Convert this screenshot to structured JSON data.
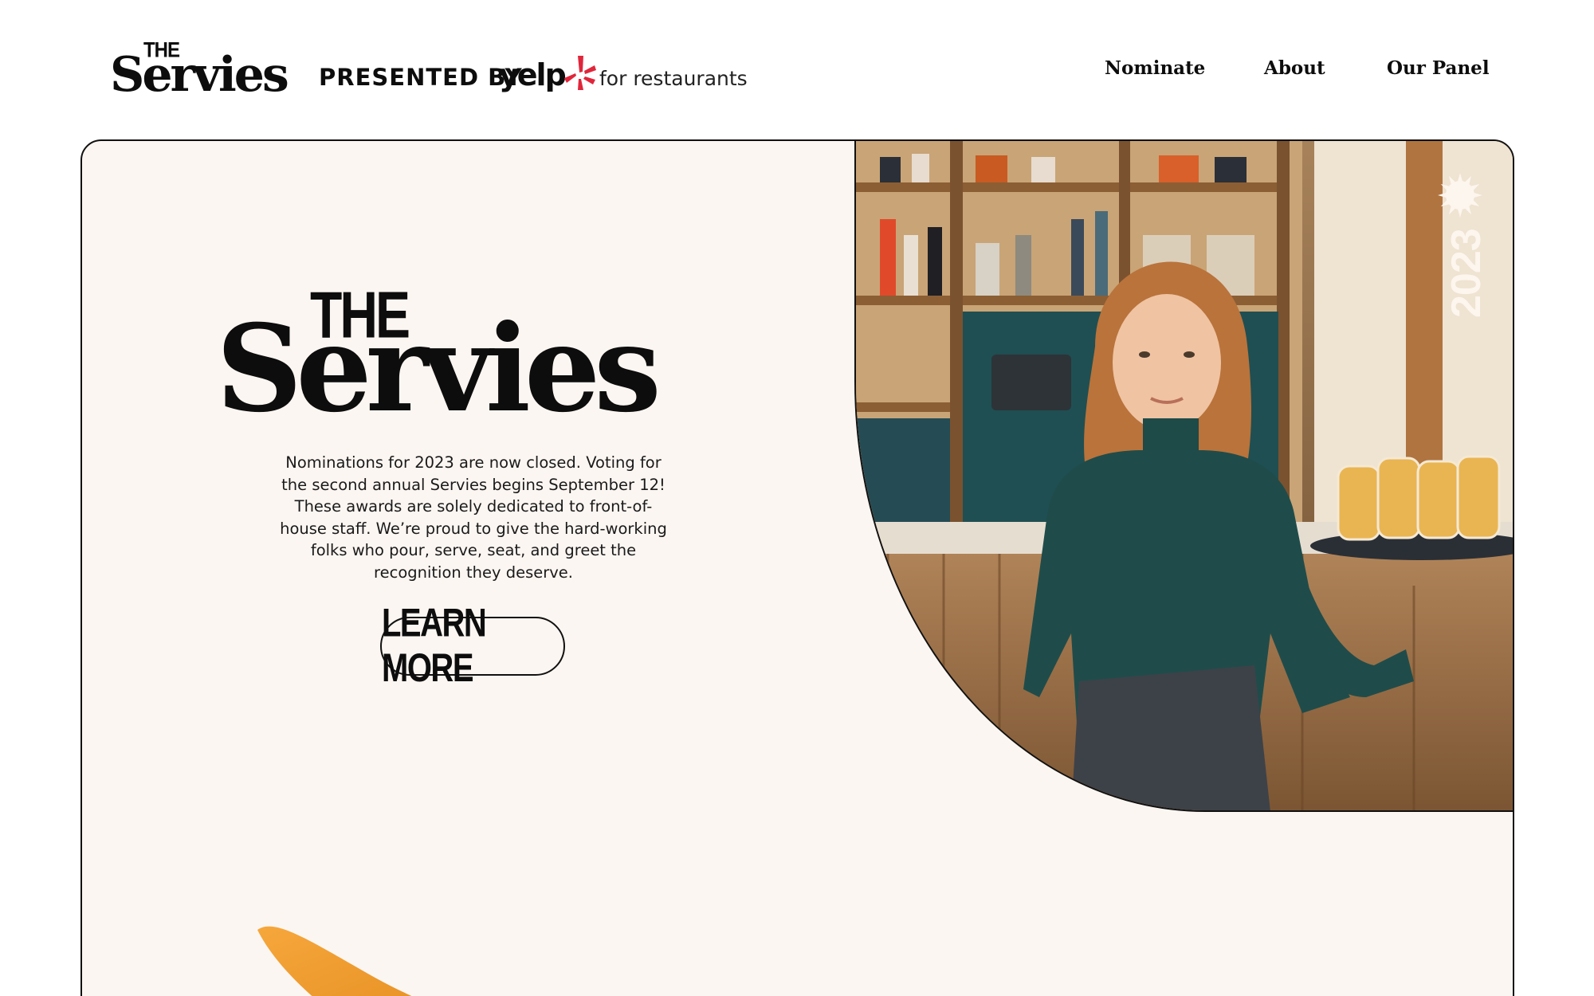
{
  "header": {
    "logo_the": "THE",
    "logo_servies": "Servies",
    "presented_by": "PRESENTED BY",
    "yelp": "yelp",
    "for_restaurants": "for restaurants",
    "nav": [
      {
        "label": "Nominate"
      },
      {
        "label": "About"
      },
      {
        "label": "Our Panel"
      }
    ]
  },
  "hero": {
    "the": "THE",
    "title": "Servies",
    "intro": "Nominations for 2023 are now closed. Voting for the second annual Servies begins September 12! These awards are solely dedicated to front-of-house staff. We’re proud to give the hard-working folks who pour, serve, seat, and greet the recognition they deserve.",
    "cta": "LEARN MORE",
    "year": "2023"
  },
  "colors": {
    "card_background": "#fcf6f2",
    "ink": "#0d0d0d",
    "yelp_red": "#e0263b",
    "badge_white": "#fdf6ee"
  },
  "icons": {
    "yelp_burst": "yelp-burst-icon",
    "badge_burst": "starburst-icon"
  }
}
